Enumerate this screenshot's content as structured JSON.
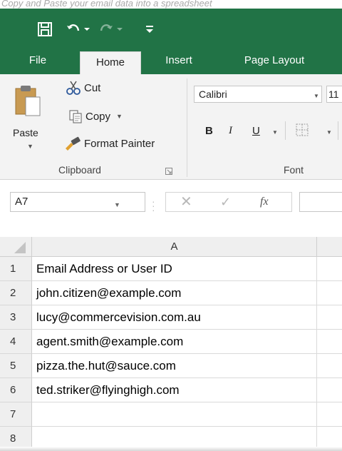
{
  "caption": "Copy and Paste your email data into a spreadsheet",
  "toolbar": {
    "save_icon": "save-icon",
    "undo_icon": "undo-icon",
    "redo_icon": "redo-icon",
    "customize_icon": "customize-quick-access-icon"
  },
  "tabs": [
    {
      "label": "File",
      "active": false
    },
    {
      "label": "Home",
      "active": true
    },
    {
      "label": "Insert",
      "active": false
    },
    {
      "label": "Page Layout",
      "active": false
    }
  ],
  "clipboard": {
    "paste_label": "Paste",
    "cut_label": "Cut",
    "copy_label": "Copy",
    "format_painter_label": "Format Painter",
    "group_label": "Clipboard"
  },
  "font": {
    "name": "Calibri",
    "size": "11",
    "bold": "B",
    "italic": "I",
    "underline": "U",
    "group_label": "Font"
  },
  "formula_bar": {
    "name_box": "A7",
    "cancel": "✕",
    "enter": "✓",
    "fx": "fx",
    "value": ""
  },
  "grid": {
    "columns": [
      "A"
    ],
    "rows": [
      {
        "num": "1",
        "a": "Email Address or User ID"
      },
      {
        "num": "2",
        "a": "john.citizen@example.com"
      },
      {
        "num": "3",
        "a": "lucy@commercevision.com.au"
      },
      {
        "num": "4",
        "a": "agent.smith@example.com"
      },
      {
        "num": "5",
        "a": "pizza.the.hut@sauce.com"
      },
      {
        "num": "6",
        "a": "ted.striker@flyinghigh.com"
      },
      {
        "num": "7",
        "a": ""
      },
      {
        "num": "8",
        "a": ""
      }
    ]
  },
  "colors": {
    "titlebar": "#217346",
    "ribbon": "#f3f3f3",
    "header": "#efefef"
  }
}
